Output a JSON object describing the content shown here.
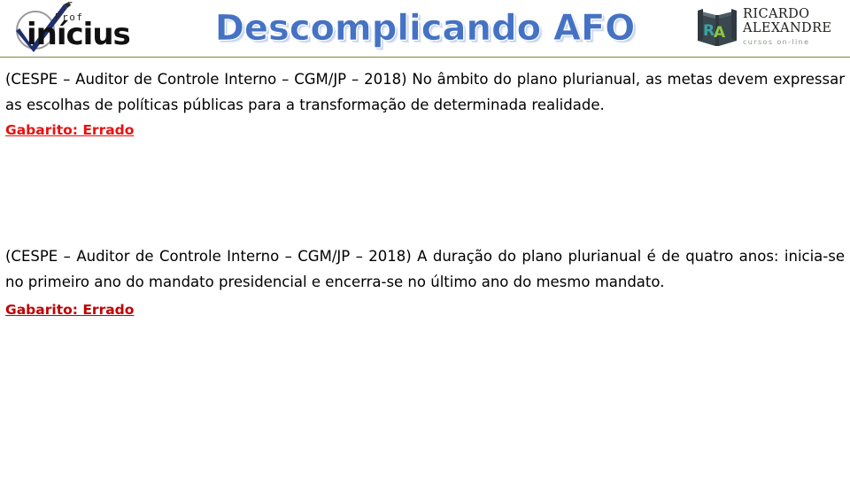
{
  "header": {
    "title": "Descomplicando AFO",
    "title_color": "#4472c4",
    "rule_color": "#79893b",
    "left_logo": {
      "prof_label": "Prof",
      "name": "inícius",
      "full_name": "Prof Vinícius",
      "check_color": "#1f3070",
      "circle_color": "#9a9a9a"
    },
    "right_logo": {
      "monogram": "RA",
      "line1": "RICARDO",
      "line2": "ALEXANDRE",
      "tagline": "cursos on-line",
      "book_color": "#3b474f",
      "r_color": "#3aa6a0",
      "a_color": "#8cc63f",
      "tagline_color": "#8d9a8a"
    }
  },
  "content": {
    "questions": [
      {
        "text": "(CESPE – Auditor de Controle Interno – CGM/JP – 2018) No âmbito do plano plurianual, as metas devem expressar as escolhas de políticas públicas para a transformação de determinada realidade.",
        "answer": "Gabarito: Errado",
        "answer_color": "#e8110f"
      },
      {
        "text": "(CESPE – Auditor de Controle Interno – CGM/JP – 2018) A duração do plano plurianual é de quatro anos: inicia-se no primeiro ano do mandato presidencial e encerra-se no último ano do mesmo mandato.",
        "answer": "Gabarito: Errado",
        "answer_color": "#c00000"
      }
    ]
  }
}
